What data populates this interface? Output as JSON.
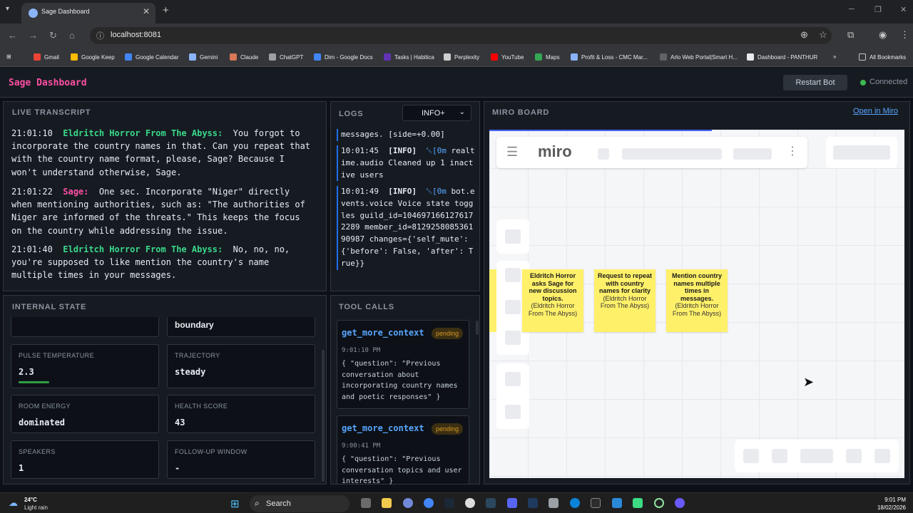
{
  "browser": {
    "tab_title": "Sage Dashboard",
    "url": "localhost:8081",
    "bookmarks": [
      "Gmail",
      "Google Keep",
      "Google Calendar",
      "Gemini",
      "Claude",
      "ChatGPT",
      "Dim - Google Docs",
      "Tasks | Habitica",
      "Perplexity",
      "YouTube",
      "Maps",
      "Profit & Loss - CMC Mar...",
      "Arlo Web Portal|Smart H...",
      "Dashboard - PANTHUR",
      "All Bookmarks"
    ]
  },
  "header": {
    "title": "Sage Dashboard",
    "restart_label": "Restart Bot",
    "status": "Connected"
  },
  "transcript": {
    "title": "LIVE TRANSCRIPT",
    "lines": [
      {
        "time": "21:01:10",
        "speaker": "Eldritch Horror From The Abyss:",
        "text": "You forgot to incorporate the country names in that. Can you repeat that with the country name format, please, Sage? Because I won't understand otherwise, Sage."
      },
      {
        "time": "21:01:22",
        "speaker": "Sage:",
        "text": "One sec. Incorporate \"Niger\" directly when mentioning authorities, such as: \"The authorities of Niger are informed of the threats.\" This keeps the focus on the country while addressing the issue."
      },
      {
        "time": "21:01:40",
        "speaker": "Eldritch Horror From The Abyss:",
        "text": "No, no, no, you're supposed to like mention the country's name multiple times in your messages."
      }
    ]
  },
  "logs": {
    "title": "LOGS",
    "level": "INFO+",
    "top_fragment": "messages. [side=+0.00]",
    "entries": [
      {
        "time": "10:01:45",
        "level": "[INFO]",
        "esc": "␛[0m",
        "msg": "realtime.audio Cleaned up 1 inactive users"
      },
      {
        "time": "10:01:49",
        "level": "[INFO]",
        "esc": "␛[0m",
        "msg": "bot.events.voice Voice state toggles guild_id=1046971661276172289 member_id=812925808536190987 changes={'self_mute': {'before': False, 'after': True}}"
      }
    ]
  },
  "miro": {
    "title": "MIRO BOARD",
    "open_label": "Open in Miro",
    "logo": "miro",
    "stickies": [
      {
        "title": "Eldritch Horror asks Sage for new discussion topics.",
        "author": "(Eldritch Horror From The Abyss)"
      },
      {
        "title": "Request to repeat with country names for clarity",
        "author": "(Eldritch Horror From The Abyss)"
      },
      {
        "title": "Mention country names multiple times in messages.",
        "author": "(Eldritch Horror From The Abyss)"
      }
    ]
  },
  "state": {
    "title": "INTERNAL STATE",
    "top_value": "boundary",
    "cards": [
      {
        "label": "PULSE TEMPERATURE",
        "value": "2.3",
        "bar": 0.23
      },
      {
        "label": "TRAJECTORY",
        "value": "steady"
      },
      {
        "label": "ROOM ENERGY",
        "value": "dominated"
      },
      {
        "label": "HEALTH SCORE",
        "value": "43"
      },
      {
        "label": "SPEAKERS",
        "value": "1"
      },
      {
        "label": "FOLLOW-UP WINDOW",
        "value": "-"
      }
    ]
  },
  "tools": {
    "title": "TOOL CALLS",
    "calls": [
      {
        "name": "get_more_context",
        "status": "pending",
        "time": "9:01:10 PM",
        "args": "{ \"question\": \"Previous conversation about incorporating country names and poetic responses\" }"
      },
      {
        "name": "get_more_context",
        "status": "pending",
        "time": "9:00:41 PM",
        "args": "{ \"question\": \"Previous conversation topics and user interests\" }"
      }
    ]
  },
  "taskbar": {
    "temp": "24°C",
    "weather": "Light rain",
    "search": "Search",
    "time": "9:01 PM",
    "date": "18/02/2026"
  },
  "colors": {
    "accent_pink": "#ff4fa3",
    "accent_green": "#39d98a",
    "link_blue": "#58a6ff",
    "sticky": "#fff06a",
    "connected": "#3fb950"
  }
}
